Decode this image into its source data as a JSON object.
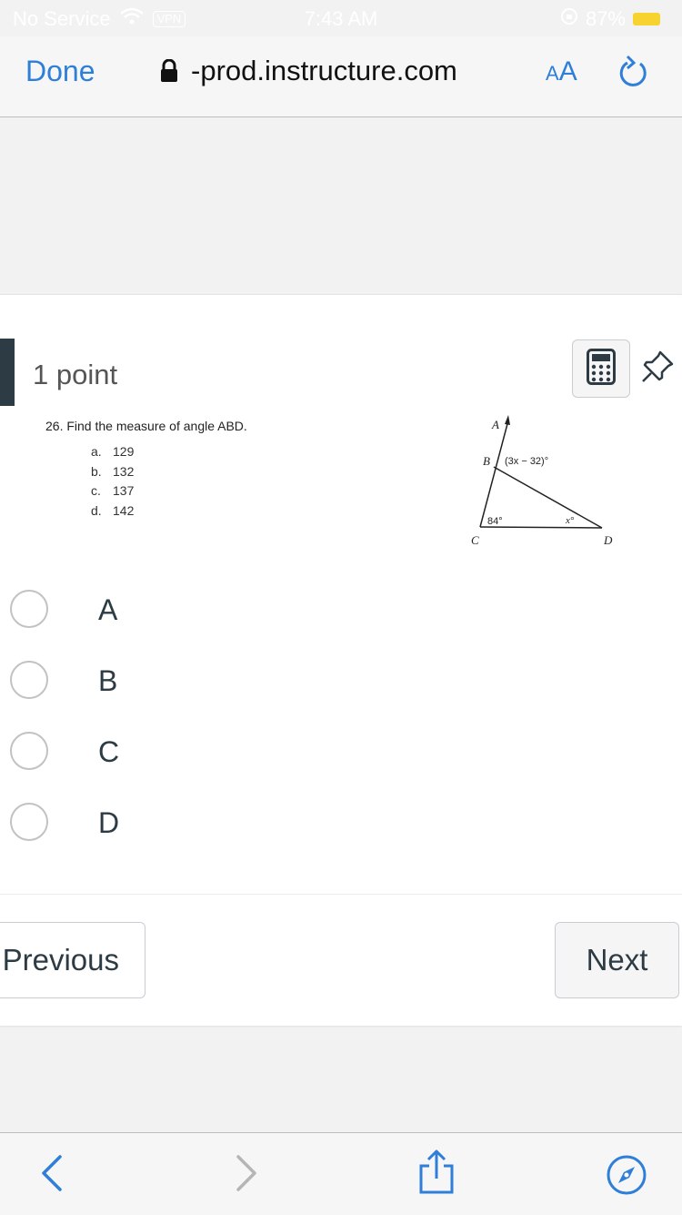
{
  "status_bar": {
    "carrier": "No Service",
    "vpn": "VPN",
    "time": "7:43 AM",
    "battery": "87%"
  },
  "browser": {
    "done_label": "Done",
    "url": "-prod.instructure.com",
    "text_size_label_small": "A",
    "text_size_label_large": "A"
  },
  "question": {
    "points": "1 point",
    "prompt": "26. Find the measure of angle ABD.",
    "options": [
      {
        "letter": "a.",
        "value": "129"
      },
      {
        "letter": "b.",
        "value": "132"
      },
      {
        "letter": "c.",
        "value": "137"
      },
      {
        "letter": "d.",
        "value": "142"
      }
    ],
    "diagram": {
      "label_a": "A",
      "label_b": "B",
      "label_c": "C",
      "label_d": "D",
      "angle_b": "(3x − 32)°",
      "angle_c": "84°",
      "angle_d": "x°"
    }
  },
  "answers": [
    "A",
    "B",
    "C",
    "D"
  ],
  "navigation": {
    "previous_label": "Previous",
    "next_label": "Next"
  },
  "colors": {
    "link_blue": "#2f7fd9",
    "accent_dark": "#2d3b45",
    "battery_yellow": "#f7d32f"
  },
  "icons": [
    "lock-icon",
    "reload-icon",
    "calculator-icon",
    "pin-icon",
    "back-arrow-icon",
    "forward-arrow-icon",
    "share-icon",
    "compass-icon"
  ]
}
